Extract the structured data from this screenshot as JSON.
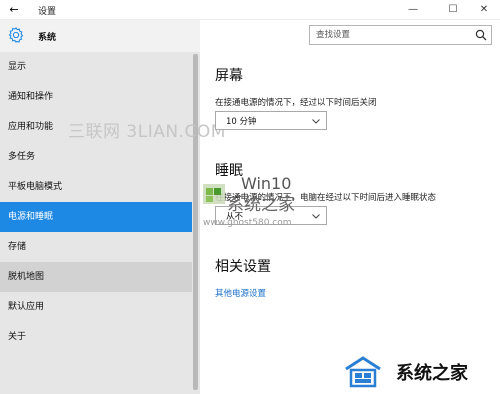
{
  "window": {
    "title": "设置",
    "back_glyph": "←",
    "minimize_glyph": "—",
    "maximize_glyph": "☐",
    "close_glyph": "✕"
  },
  "sidebar": {
    "header_icon": "gear-icon",
    "title": "系统",
    "items": [
      {
        "label": "显示"
      },
      {
        "label": "通知和操作"
      },
      {
        "label": "应用和功能"
      },
      {
        "label": "多任务"
      },
      {
        "label": "平板电脑模式"
      },
      {
        "label": "电源和睡眠",
        "state": "selected"
      },
      {
        "label": "存储"
      },
      {
        "label": "脱机地图",
        "state": "hover"
      },
      {
        "label": "默认应用"
      },
      {
        "label": "关于"
      }
    ]
  },
  "search": {
    "placeholder": "查找设置",
    "icon": "search-icon"
  },
  "screen": {
    "heading": "屏幕",
    "description": "在接通电源的情况下，经过以下时间后关闭",
    "dropdown_value": "10 分钟"
  },
  "sleep": {
    "heading": "睡眠",
    "description": "在接通电源的情况下，电脑在经过以下时间后进入睡眠状态",
    "dropdown_value": "从不"
  },
  "related": {
    "heading": "相关设置",
    "link": "其他电源设置"
  },
  "watermarks": {
    "sanlian": "三联网 3LIAN.COM",
    "win10_title": "Win10",
    "win10_cn": "系统之家",
    "ghost_url": "www.ghost580.com",
    "bottom_text": "系统之家"
  },
  "colors": {
    "accent": "#1e88e5",
    "link": "#1a6fc9",
    "sidebar_bg": "#e6e6e6"
  }
}
